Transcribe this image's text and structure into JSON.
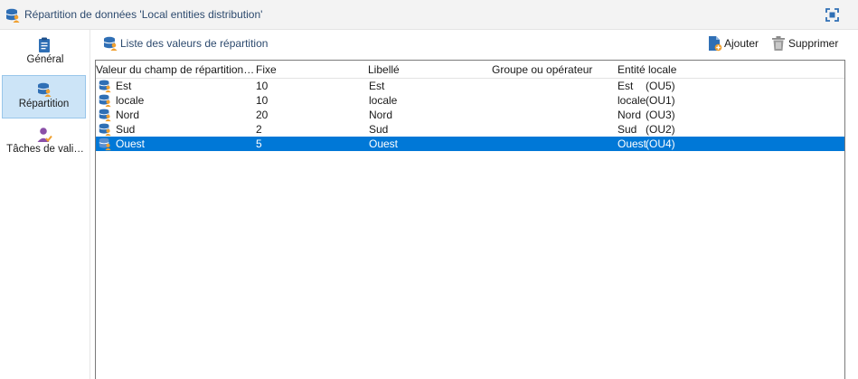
{
  "window": {
    "title": "Répartition de données 'Local entities distribution'",
    "maximize_icon": "maximize-icon"
  },
  "sidebar": {
    "items": [
      {
        "label": "Général",
        "icon": "clipboard-icon",
        "active": false
      },
      {
        "label": "Répartition",
        "icon": "database-user-icon",
        "active": true
      },
      {
        "label": "Tâches de vali…",
        "icon": "user-approval-icon",
        "active": false
      }
    ]
  },
  "toolbar": {
    "list_label": "Liste des valeurs de répartition",
    "add_label": "Ajouter",
    "delete_label": "Supprimer"
  },
  "table": {
    "columns": [
      "Valeur du champ de répartition…",
      "Fixe",
      "Libellé",
      "Groupe ou opérateur",
      "Entité locale"
    ],
    "rows": [
      {
        "value": "Est",
        "fixe": "10",
        "libelle": "Est",
        "groupe": "",
        "entite_name": "Est",
        "entite_code": "(OU5)",
        "selected": false
      },
      {
        "value": "locale",
        "fixe": "10",
        "libelle": "locale",
        "groupe": "",
        "entite_name": "locale",
        "entite_code": "(OU1)",
        "selected": false
      },
      {
        "value": "Nord",
        "fixe": "20",
        "libelle": "Nord",
        "groupe": "",
        "entite_name": "Nord",
        "entite_code": "(OU3)",
        "selected": false
      },
      {
        "value": "Sud",
        "fixe": "2",
        "libelle": "Sud",
        "groupe": "",
        "entite_name": "Sud",
        "entite_code": "(OU2)",
        "selected": false
      },
      {
        "value": "Ouest",
        "fixe": "5",
        "libelle": "Ouest",
        "groupe": "",
        "entite_name": "Ouest",
        "entite_code": "(OU4)",
        "selected": true
      }
    ]
  },
  "colors": {
    "accent": "#0078d7",
    "selection_bg": "#cce4f7",
    "title_text": "#2d4a6e"
  }
}
